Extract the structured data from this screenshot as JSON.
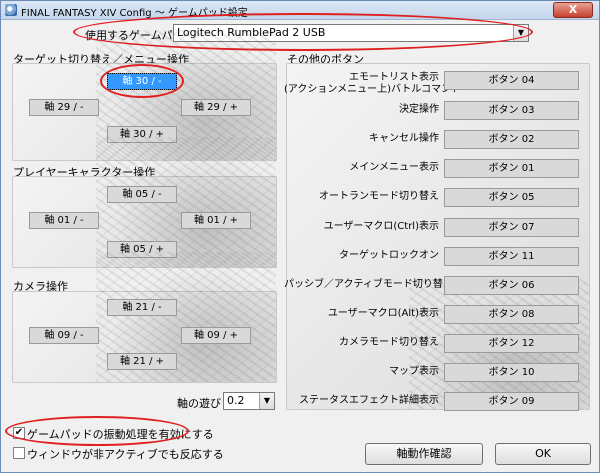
{
  "window": {
    "title": "FINAL FANTASY XIV Config ～ ゲームパッド設定",
    "close_label": "X"
  },
  "gamepad": {
    "label": "使用するゲームパッド",
    "value": "Logitech RumblePad 2 USB"
  },
  "target_group": {
    "label": "ターゲット切り替え／メニュー操作",
    "up": "軸 30 / -",
    "left": "軸 29 / -",
    "right": "軸 29 / +",
    "down": "軸 30 / +"
  },
  "player_group": {
    "label": "プレイヤーキャラクター操作",
    "up": "軸 05 / -",
    "left": "軸 01 / -",
    "right": "軸 01 / +",
    "down": "軸 05 / +"
  },
  "camera_group": {
    "label": "カメラ操作",
    "up": "軸 21 / -",
    "left": "軸 09 / -",
    "right": "軸 09 / +",
    "down": "軸 21 / +"
  },
  "deadzone": {
    "label": "軸の遊び",
    "value": "0.2"
  },
  "other_buttons": {
    "label": "その他のボタン",
    "rows": [
      {
        "label": "エモートリスト表示\n(アクションメニュー上)バトルコマンド",
        "value": "ボタン 04"
      },
      {
        "label": "決定操作",
        "value": "ボタン 03"
      },
      {
        "label": "キャンセル操作",
        "value": "ボタン 02"
      },
      {
        "label": "メインメニュー表示",
        "value": "ボタン 01"
      },
      {
        "label": "オートランモード切り替え",
        "value": "ボタン 05"
      },
      {
        "label": "ユーザーマクロ(Ctrl)表示",
        "value": "ボタン 07"
      },
      {
        "label": "ターゲットロックオン",
        "value": "ボタン 11"
      },
      {
        "label": "パッシブ／アクティブモード切り替え",
        "value": "ボタン 06"
      },
      {
        "label": "ユーザーマクロ(Alt)表示",
        "value": "ボタン 08"
      },
      {
        "label": "カメラモード切り替え",
        "value": "ボタン 12"
      },
      {
        "label": "マップ表示",
        "value": "ボタン 10"
      },
      {
        "label": "ステータスエフェクト詳細表示",
        "value": "ボタン 09"
      }
    ]
  },
  "options": {
    "vibration": {
      "label": "ゲームパッドの振動処理を有効にする",
      "checked": true,
      "mark": "✔"
    },
    "background": {
      "label": "ウィンドウが非アクティブでも反応する",
      "checked": false,
      "mark": ""
    }
  },
  "buttons": {
    "test": "軸動作確認",
    "ok": "OK"
  }
}
